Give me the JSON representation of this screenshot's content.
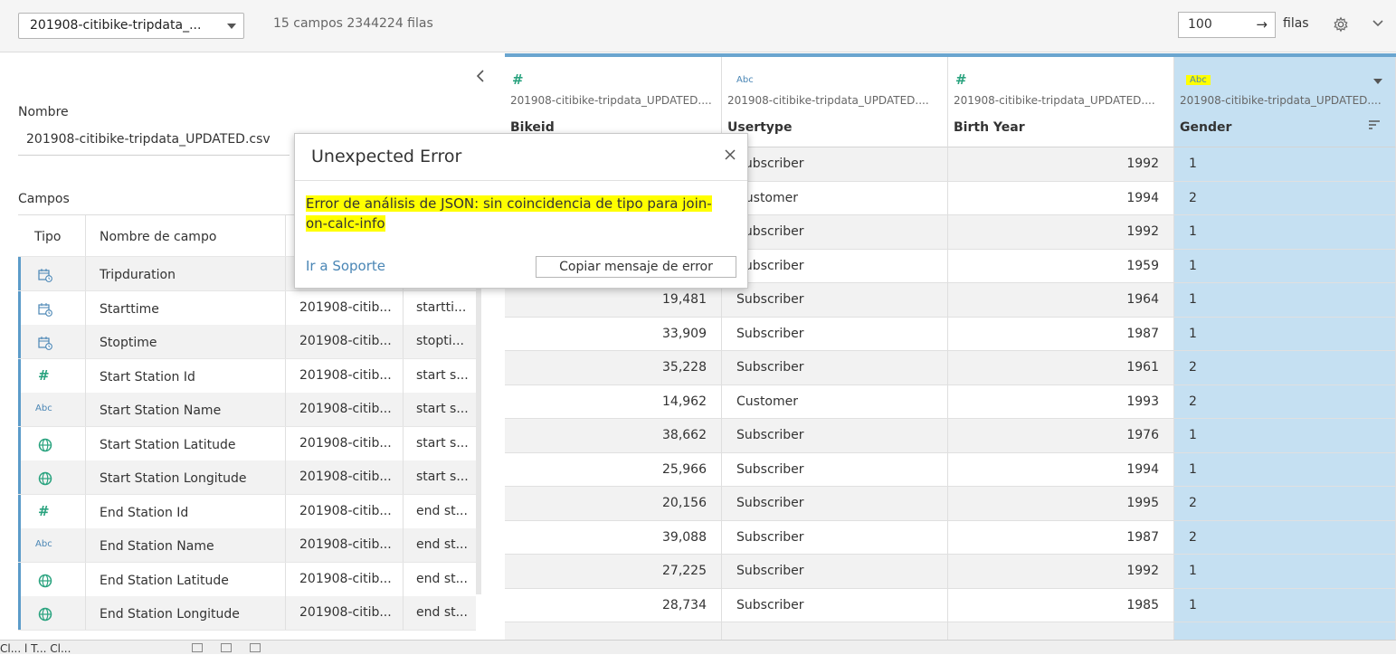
{
  "toolbar": {
    "datasource": "201908-citibike-tripdata_...",
    "meta": "15 campos 2344224 filas",
    "rows_value": "100",
    "rows_label": "filas"
  },
  "left": {
    "nombre_label": "Nombre",
    "nombre_value": "201908-citibike-tripdata_UPDATED.csv",
    "campos_label": "Campos",
    "col_tipo": "Tipo",
    "col_nombre": "Nombre de campo",
    "fields": [
      {
        "type": "date",
        "name": "Tripduration",
        "table": "",
        "remote": ""
      },
      {
        "type": "date",
        "name": "Starttime",
        "table": "201908-citib...",
        "remote": "startti..."
      },
      {
        "type": "date",
        "name": "Stoptime",
        "table": "201908-citib...",
        "remote": "stopti..."
      },
      {
        "type": "number",
        "name": "Start Station Id",
        "table": "201908-citib...",
        "remote": "start s..."
      },
      {
        "type": "string",
        "name": "Start Station Name",
        "table": "201908-citib...",
        "remote": "start s..."
      },
      {
        "type": "geo",
        "name": "Start Station Latitude",
        "table": "201908-citib...",
        "remote": "start s..."
      },
      {
        "type": "geo",
        "name": "Start Station Longitude",
        "table": "201908-citib...",
        "remote": "start s..."
      },
      {
        "type": "number",
        "name": "End Station Id",
        "table": "201908-citib...",
        "remote": "end st..."
      },
      {
        "type": "string",
        "name": "End Station Name",
        "table": "201908-citib...",
        "remote": "end st..."
      },
      {
        "type": "geo",
        "name": "End Station Latitude",
        "table": "201908-citib...",
        "remote": "end st..."
      },
      {
        "type": "geo",
        "name": "End Station Longitude",
        "table": "201908-citib...",
        "remote": "end st..."
      }
    ]
  },
  "grid": {
    "columns": [
      {
        "type_icon": "#",
        "source": "201908-citibike-tripdata_UPDATED....",
        "name": "Bikeid",
        "align": "num"
      },
      {
        "type_icon": "Abc",
        "source": "201908-citibike-tripdata_UPDATED....",
        "name": "Usertype",
        "align": "txt"
      },
      {
        "type_icon": "#",
        "source": "201908-citibike-tripdata_UPDATED....",
        "name": "Birth Year",
        "align": "num"
      },
      {
        "type_icon": "Abc",
        "source": "201908-citibike-tripdata_UPDATED....",
        "name": "Gender",
        "align": "txt",
        "selected": true
      }
    ],
    "rows": [
      [
        "",
        "Subscriber",
        "1992",
        "1"
      ],
      [
        "",
        "Customer",
        "1994",
        "2"
      ],
      [
        "",
        "Subscriber",
        "1992",
        "1"
      ],
      [
        "",
        "Subscriber",
        "1959",
        "1"
      ],
      [
        "19,481",
        "Subscriber",
        "1964",
        "1"
      ],
      [
        "33,909",
        "Subscriber",
        "1987",
        "1"
      ],
      [
        "35,228",
        "Subscriber",
        "1961",
        "2"
      ],
      [
        "14,962",
        "Customer",
        "1993",
        "2"
      ],
      [
        "38,662",
        "Subscriber",
        "1976",
        "1"
      ],
      [
        "25,966",
        "Subscriber",
        "1994",
        "1"
      ],
      [
        "20,156",
        "Subscriber",
        "1995",
        "2"
      ],
      [
        "39,088",
        "Subscriber",
        "1987",
        "2"
      ],
      [
        "27,225",
        "Subscriber",
        "1992",
        "1"
      ],
      [
        "28,734",
        "Subscriber",
        "1985",
        "1"
      ],
      [
        "",
        "",
        "",
        ""
      ]
    ]
  },
  "dialog": {
    "title": "Unexpected Error",
    "message": "Error de análisis de JSON: sin coincidencia de tipo para join-on-calc-info",
    "support_link": "Ir a Soporte",
    "copy_button": "Copiar mensaje de error"
  },
  "bottom": {
    "sheet": "Cl... l T... Cl..."
  },
  "colors": {
    "accent": "#6aa5cf",
    "selected_column": "#c5e0f2",
    "highlight": "#ffff00",
    "link": "#4a86b5",
    "number_icon": "#2aa37f"
  }
}
